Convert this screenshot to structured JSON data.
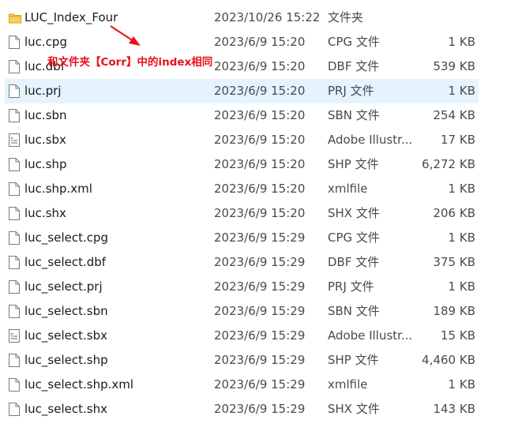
{
  "files": [
    {
      "name": "LUC_Index_Four",
      "date": "2023/10/26 15:22",
      "type": "文件夹",
      "size": "",
      "icon": "folder-icon"
    },
    {
      "name": "luc.cpg",
      "date": "2023/6/9 15:20",
      "type": "CPG 文件",
      "size": "1 KB",
      "icon": "file-icon"
    },
    {
      "name": "luc.dbf",
      "date": "2023/6/9 15:20",
      "type": "DBF 文件",
      "size": "539 KB",
      "icon": "file-icon"
    },
    {
      "name": "luc.prj",
      "date": "2023/6/9 15:20",
      "type": "PRJ 文件",
      "size": "1 KB",
      "icon": "file-icon"
    },
    {
      "name": "luc.sbn",
      "date": "2023/6/9 15:20",
      "type": "SBN 文件",
      "size": "254 KB",
      "icon": "file-icon"
    },
    {
      "name": "luc.sbx",
      "date": "2023/6/9 15:20",
      "type": "Adobe Illustr...",
      "size": "17 KB",
      "icon": "text-file-icon"
    },
    {
      "name": "luc.shp",
      "date": "2023/6/9 15:20",
      "type": "SHP 文件",
      "size": "6,272 KB",
      "icon": "file-icon"
    },
    {
      "name": "luc.shp.xml",
      "date": "2023/6/9 15:20",
      "type": "xmlfile",
      "size": "1 KB",
      "icon": "file-icon"
    },
    {
      "name": "luc.shx",
      "date": "2023/6/9 15:20",
      "type": "SHX 文件",
      "size": "206 KB",
      "icon": "file-icon"
    },
    {
      "name": "luc_select.cpg",
      "date": "2023/6/9 15:29",
      "type": "CPG 文件",
      "size": "1 KB",
      "icon": "file-icon"
    },
    {
      "name": "luc_select.dbf",
      "date": "2023/6/9 15:29",
      "type": "DBF 文件",
      "size": "375 KB",
      "icon": "file-icon"
    },
    {
      "name": "luc_select.prj",
      "date": "2023/6/9 15:29",
      "type": "PRJ 文件",
      "size": "1 KB",
      "icon": "file-icon"
    },
    {
      "name": "luc_select.sbn",
      "date": "2023/6/9 15:29",
      "type": "SBN 文件",
      "size": "189 KB",
      "icon": "file-icon"
    },
    {
      "name": "luc_select.sbx",
      "date": "2023/6/9 15:29",
      "type": "Adobe Illustr...",
      "size": "15 KB",
      "icon": "text-file-icon"
    },
    {
      "name": "luc_select.shp",
      "date": "2023/6/9 15:29",
      "type": "SHP 文件",
      "size": "4,460 KB",
      "icon": "file-icon"
    },
    {
      "name": "luc_select.shp.xml",
      "date": "2023/6/9 15:29",
      "type": "xmlfile",
      "size": "1 KB",
      "icon": "file-icon"
    },
    {
      "name": "luc_select.shx",
      "date": "2023/6/9 15:29",
      "type": "SHX 文件",
      "size": "143 KB",
      "icon": "file-icon"
    }
  ],
  "selected_file": "luc.prj",
  "annotation": {
    "text": "和文件夹【Corr】中的index相同",
    "color": "#e8101a"
  },
  "colors": {
    "selection": "#e5f3ff",
    "folder": "#f5c242"
  }
}
